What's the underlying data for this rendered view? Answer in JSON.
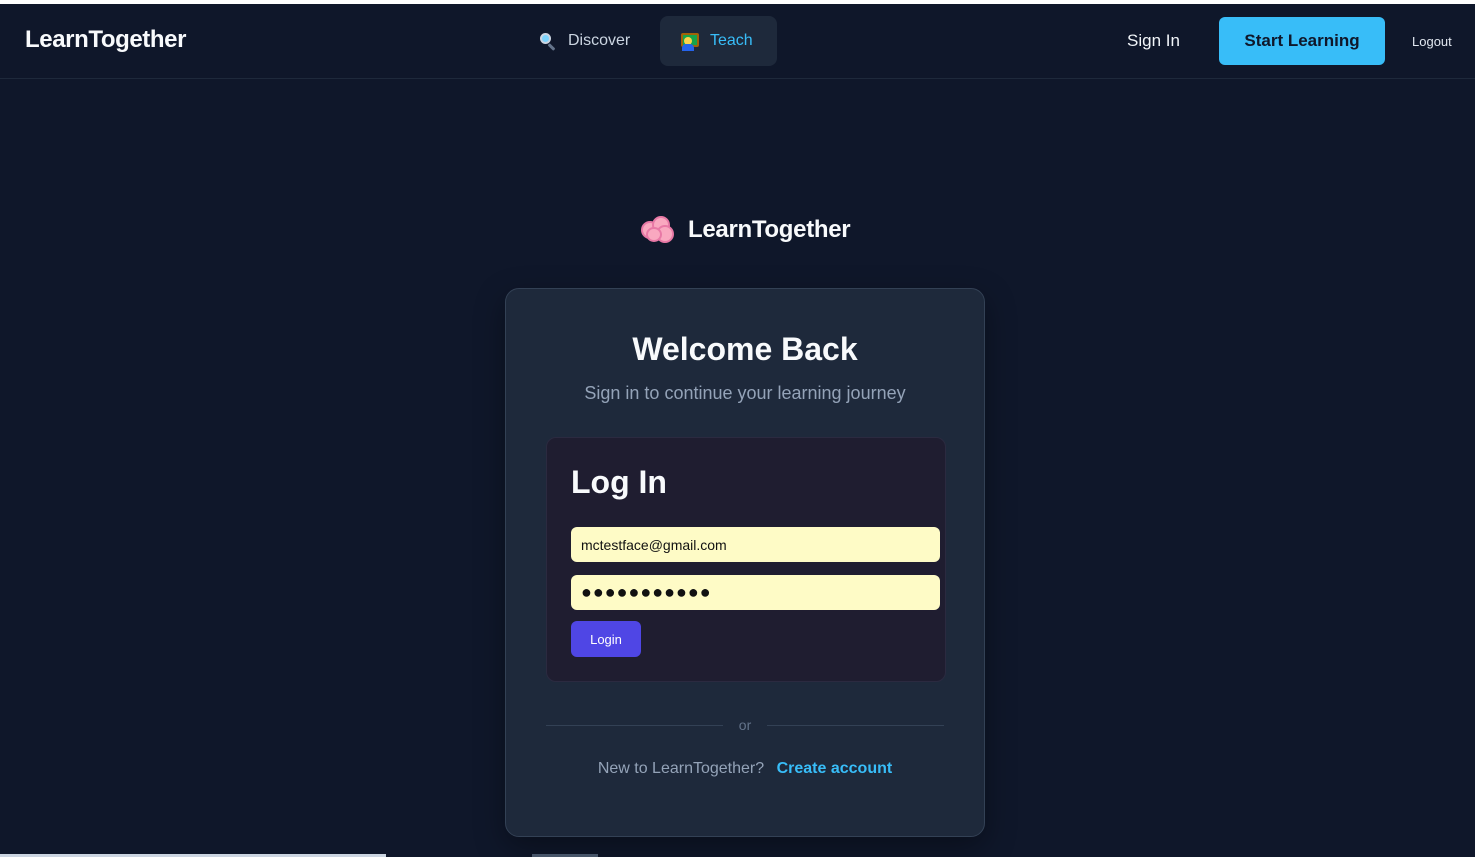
{
  "header": {
    "brand": "LearnTogether",
    "nav": {
      "discover_label": "Discover",
      "discover_icon": "magnifying-glass-icon",
      "teach_label": "Teach",
      "teach_icon": "teacher-icon"
    },
    "sign_in_label": "Sign In",
    "start_learning_label": "Start Learning",
    "logout_label": "Logout"
  },
  "logo": {
    "icon": "brain-icon",
    "text": "LearnTogether"
  },
  "card": {
    "title": "Welcome Back",
    "subtitle": "Sign in to continue your learning journey",
    "login": {
      "heading": "Log In",
      "email_value": "mctestface@gmail.com",
      "password_value": "●●●●●●●●●●●",
      "submit_label": "Login"
    },
    "divider_text": "or",
    "signup_prompt": "New to LearnTogether?",
    "create_account_label": "Create account"
  },
  "colors": {
    "background": "#0f172a",
    "card": "#1e293b",
    "accent": "#38bdf8",
    "login_button": "#4f46e5",
    "autofill_input": "#fefbc6"
  }
}
